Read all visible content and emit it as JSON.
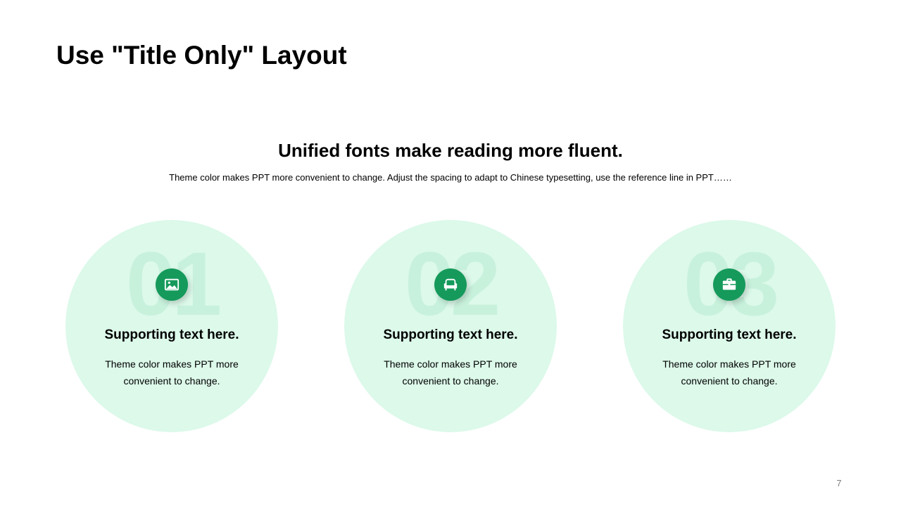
{
  "slide": {
    "title": "Use \"Title Only\" Layout",
    "heading": "Unified fonts make reading more fluent.",
    "subtitle": "Theme color makes PPT more convenient  to change. Adjust the spacing to adapt to Chinese  typesetting, use the reference line in PPT……",
    "page_number": "7"
  },
  "colors": {
    "accent": "#159a5b",
    "circle_fill": "#dcf9ea",
    "number_fill": "#b9ecd2"
  },
  "cards": [
    {
      "number": "01",
      "icon": "image-icon",
      "heading": "Supporting text here.",
      "line1": "Theme  color makes PPT more",
      "line2": "convenient  to change."
    },
    {
      "number": "02",
      "icon": "armchair-icon",
      "heading": "Supporting text here.",
      "line1": "Theme  color makes PPT more",
      "line2": "convenient  to change."
    },
    {
      "number": "03",
      "icon": "briefcase-icon",
      "heading": "Supporting text here.",
      "line1": "Theme  color makes PPT more",
      "line2": "convenient  to change."
    }
  ]
}
